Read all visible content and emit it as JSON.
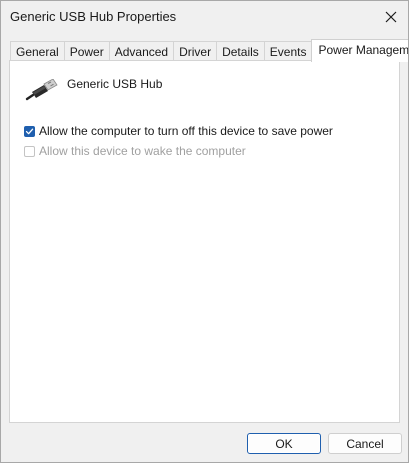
{
  "window": {
    "title": "Generic USB Hub Properties",
    "close_icon": "close-icon"
  },
  "tabs": [
    {
      "label": "General",
      "active": false
    },
    {
      "label": "Power",
      "active": false
    },
    {
      "label": "Advanced",
      "active": false
    },
    {
      "label": "Driver",
      "active": false
    },
    {
      "label": "Details",
      "active": false
    },
    {
      "label": "Events",
      "active": false
    },
    {
      "label": "Power Management",
      "active": true
    }
  ],
  "device": {
    "name": "Generic USB Hub",
    "icon": "usb-plug-icon"
  },
  "options": [
    {
      "label": "Allow the computer to turn off this device to save power",
      "checked": true,
      "enabled": true
    },
    {
      "label": "Allow this device to wake the computer",
      "checked": false,
      "enabled": false
    }
  ],
  "buttons": {
    "ok": "OK",
    "cancel": "Cancel"
  },
  "colors": {
    "accent": "#1f5fae",
    "window_bg": "#f0f0f0",
    "panel_bg": "#ffffff",
    "disabled_text": "#a0a0a0"
  }
}
